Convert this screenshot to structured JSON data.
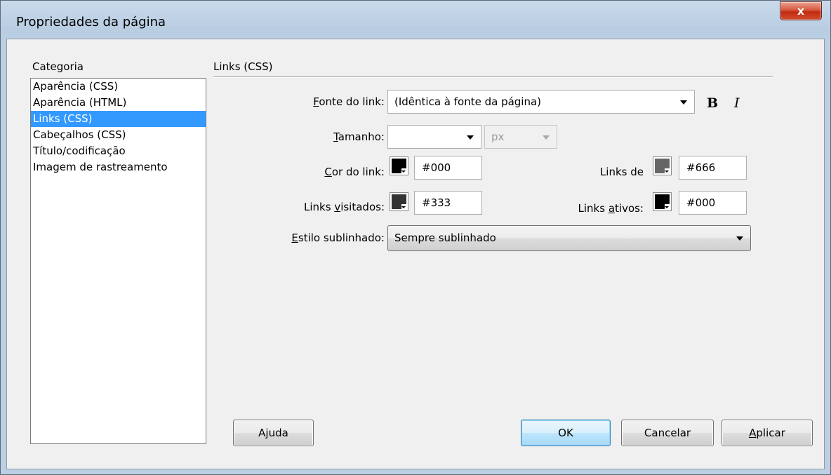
{
  "window": {
    "title": "Propriedades da página",
    "close_glyph": "x"
  },
  "category": {
    "label": "Categoria",
    "items": [
      {
        "label": "Aparência (CSS)"
      },
      {
        "label": "Aparência (HTML)"
      },
      {
        "label": "Links (CSS)",
        "selected": true
      },
      {
        "label": "Cabeçalhos (CSS)"
      },
      {
        "label": "Título/codificação"
      },
      {
        "label": "Imagem de rastreamento"
      }
    ]
  },
  "section": {
    "title": "Links (CSS)"
  },
  "fields": {
    "link_font": {
      "label_first": "F",
      "label_rest": "onte do link:",
      "value": "(Idêntica à fonte da página)"
    },
    "bold_label": "B",
    "italic_label": "I",
    "size": {
      "label_first": "T",
      "label_rest": "amanho:",
      "value": "",
      "unit": "px"
    },
    "link_color": {
      "label_first": "C",
      "label_rest": "or do link:",
      "value": "#000",
      "swatch": "#000000"
    },
    "hover_links": {
      "label": "Links de",
      "value": "#666",
      "swatch": "#666666"
    },
    "visited_links": {
      "label_pre": "Links ",
      "label_u": "v",
      "label_post": "isitados:",
      "value": "#333",
      "swatch": "#333333"
    },
    "active_links": {
      "label_pre": "Links ",
      "label_u": "a",
      "label_post": "tivos:",
      "value": "#000",
      "swatch": "#000000"
    },
    "underline_style": {
      "label_first": "E",
      "label_rest": "stilo sublinhado:",
      "value": "Sempre sublinhado"
    }
  },
  "buttons": {
    "help": {
      "pre": "A",
      "u": "j",
      "post": "uda"
    },
    "ok": "OK",
    "cancel": "Cancelar",
    "apply": {
      "u": "A",
      "post": "plicar"
    }
  },
  "colors": {
    "selection": "#3399ff",
    "close_button": "#c9462c"
  }
}
